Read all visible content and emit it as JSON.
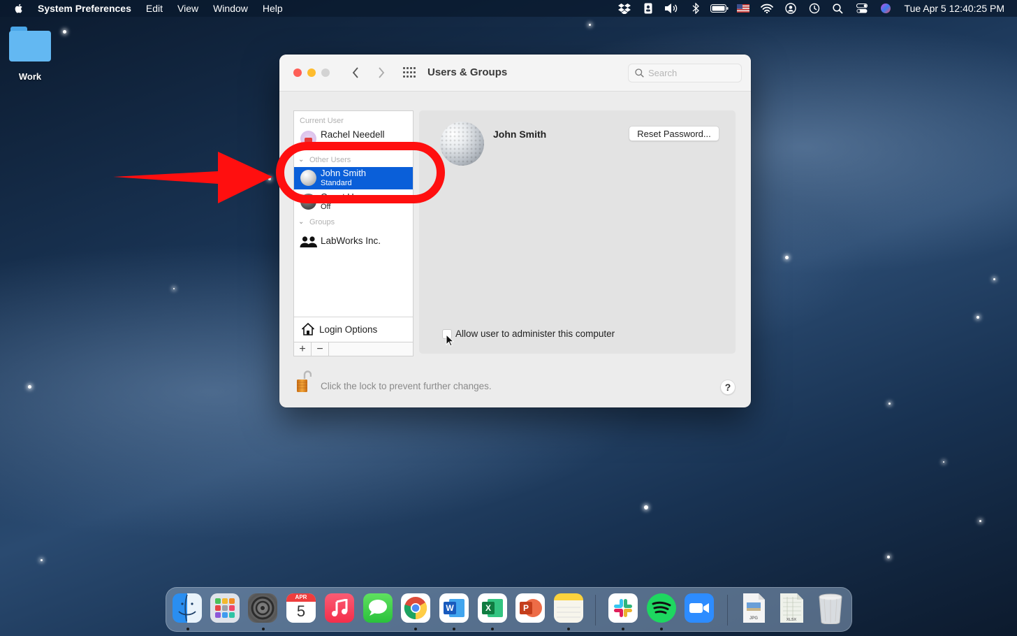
{
  "menubar": {
    "app_name": "System Preferences",
    "menus": [
      "Edit",
      "View",
      "Window",
      "Help"
    ],
    "status_icons": [
      "dropbox-icon",
      "contacts-icon",
      "volume-icon",
      "bluetooth-icon",
      "battery-icon",
      "input-source-us-flag-icon",
      "wifi-icon",
      "user-account-icon",
      "time-machine-icon",
      "spotlight-search-icon",
      "control-center-icon",
      "siri-icon"
    ],
    "clock": "Tue Apr 5  12:40:25 PM"
  },
  "desktop": {
    "folder_label": "Work"
  },
  "window": {
    "title": "Users & Groups",
    "search_placeholder": "Search",
    "sidebar": {
      "current_user_header": "Current User",
      "current_user": {
        "name": "Rachel Needell"
      },
      "other_users_header": "Other Users",
      "other_users": [
        {
          "name": "John Smith",
          "role": "Standard",
          "selected": true
        },
        {
          "name": "Guest User",
          "role": "Off",
          "selected": false
        }
      ],
      "groups_header": "Groups",
      "groups": [
        {
          "name": "LabWorks Inc."
        }
      ],
      "login_options": "Login Options",
      "add_label": "+",
      "remove_label": "−"
    },
    "detail": {
      "user_name": "John Smith",
      "reset_password_label": "Reset Password...",
      "admin_checkbox_label": "Allow user to administer this computer",
      "admin_checked": false
    },
    "footer": {
      "lock_text": "Click the lock to prevent further changes.",
      "help_label": "?"
    }
  },
  "annotation": {
    "color": "#ff0f0f",
    "target": "John Smith"
  },
  "dock": {
    "apps": [
      {
        "name": "Finder",
        "running": true
      },
      {
        "name": "Launchpad",
        "running": false
      },
      {
        "name": "System Preferences",
        "running": true
      },
      {
        "name": "Calendar",
        "running": false,
        "month": "APR",
        "day": "5"
      },
      {
        "name": "Music",
        "running": false
      },
      {
        "name": "Messages",
        "running": false
      },
      {
        "name": "Google Chrome",
        "running": true,
        "letter": ""
      },
      {
        "name": "Microsoft Word",
        "running": true,
        "letter": "W"
      },
      {
        "name": "Microsoft Excel",
        "running": true,
        "letter": "X"
      },
      {
        "name": "Microsoft PowerPoint",
        "running": false,
        "letter": "P"
      },
      {
        "name": "Notes",
        "running": true
      },
      {
        "name": "Slack",
        "running": true
      },
      {
        "name": "Spotify",
        "running": true
      },
      {
        "name": "Zoom",
        "running": false
      }
    ],
    "documents": [
      {
        "name": "JPG file",
        "label": "JPG"
      },
      {
        "name": "XLSX file",
        "label": "XLSX"
      }
    ],
    "trash": "Trash"
  }
}
